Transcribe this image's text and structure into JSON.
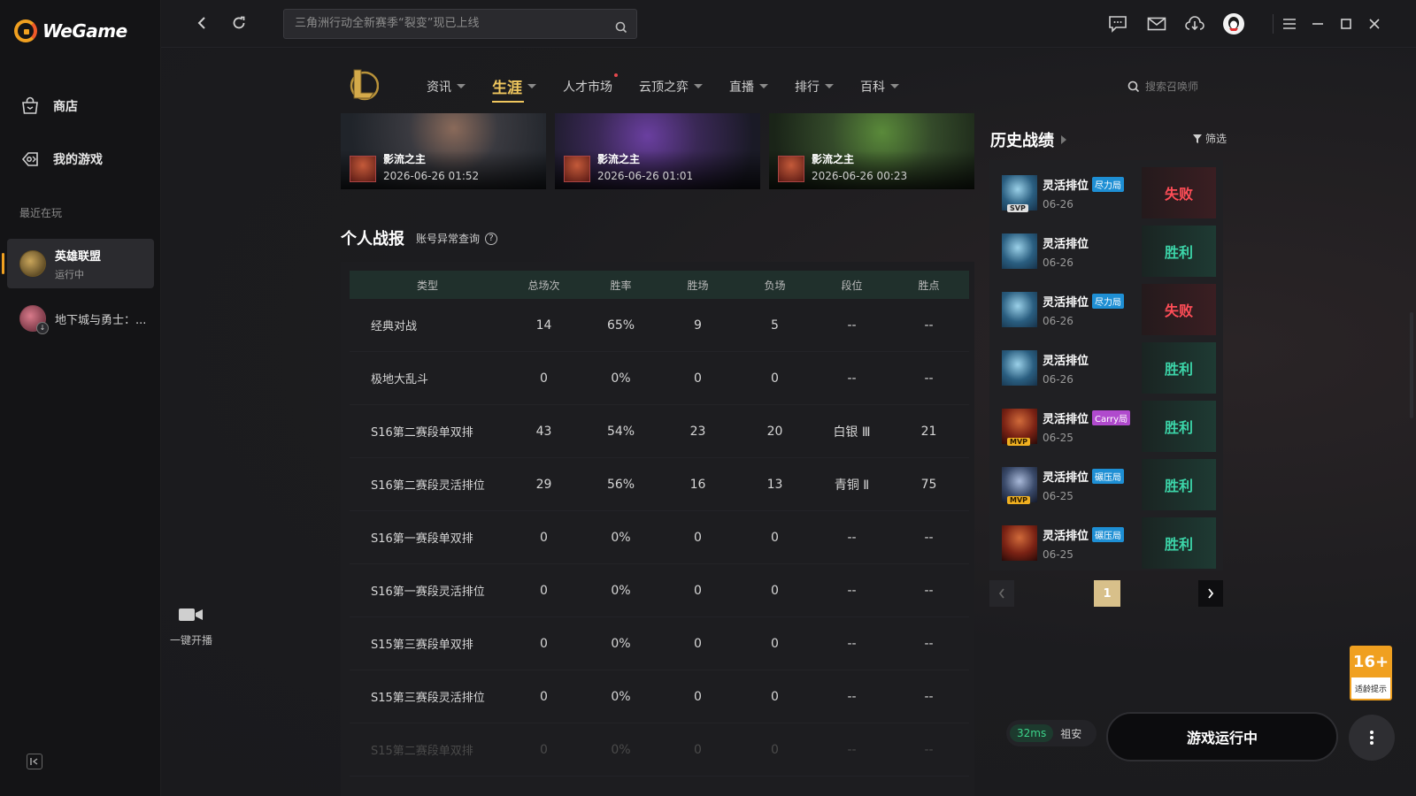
{
  "app": {
    "name": "WeGame"
  },
  "sidebar": {
    "nav": [
      {
        "label": "商店",
        "icon": "store-icon"
      },
      {
        "label": "我的游戏",
        "icon": "my-games-icon"
      }
    ],
    "recent_label": "最近在玩",
    "games": [
      {
        "name": "英雄联盟",
        "status": "运行中"
      },
      {
        "name": "地下城与勇士：..."
      }
    ]
  },
  "topbar": {
    "search_placeholder": "三角洲行动全新赛季“裂变”现已上线"
  },
  "subnav": {
    "tabs": [
      {
        "label": "资讯",
        "dropdown": true
      },
      {
        "label": "生涯",
        "dropdown": true,
        "active": true
      },
      {
        "label": "人才市场",
        "dropdown": false,
        "dot": true
      },
      {
        "label": "云顶之弈",
        "dropdown": true
      },
      {
        "label": "直播",
        "dropdown": true
      },
      {
        "label": "排行",
        "dropdown": true
      },
      {
        "label": "百科",
        "dropdown": true
      }
    ],
    "summoner_search_placeholder": "搜索召唤师"
  },
  "highlights": [
    {
      "title": "影流之主",
      "time": "2026-06-26 01:52"
    },
    {
      "title": "影流之主",
      "time": "2026-06-26 01:01"
    },
    {
      "title": "影流之主",
      "time": "2026-06-26 00:23"
    }
  ],
  "personal_stats": {
    "title": "个人战报",
    "anomaly_link": "账号异常查询",
    "headers": [
      "类型",
      "总场次",
      "胜率",
      "胜场",
      "负场",
      "段位",
      "胜点"
    ],
    "rows": [
      [
        "经典对战",
        "14",
        "65%",
        "9",
        "5",
        "--",
        "--"
      ],
      [
        "极地大乱斗",
        "0",
        "0%",
        "0",
        "0",
        "--",
        "--"
      ],
      [
        "S16第二赛段单双排",
        "43",
        "54%",
        "23",
        "20",
        "白银 Ⅲ",
        "21"
      ],
      [
        "S16第二赛段灵活排位",
        "29",
        "56%",
        "16",
        "13",
        "青铜 Ⅱ",
        "75"
      ],
      [
        "S16第一赛段单双排",
        "0",
        "0%",
        "0",
        "0",
        "--",
        "--"
      ],
      [
        "S16第一赛段灵活排位",
        "0",
        "0%",
        "0",
        "0",
        "--",
        "--"
      ],
      [
        "S15第三赛段单双排",
        "0",
        "0%",
        "0",
        "0",
        "--",
        "--"
      ],
      [
        "S15第三赛段灵活排位",
        "0",
        "0%",
        "0",
        "0",
        "--",
        "--"
      ],
      [
        "S15第二赛段单双排",
        "0",
        "0%",
        "0",
        "0",
        "--",
        "--"
      ]
    ]
  },
  "history": {
    "title": "历史战绩",
    "filter_label": "筛选",
    "matches": [
      {
        "mode": "灵活排位",
        "tag": "尽力局",
        "tag_color": "blue",
        "badge": "SVP",
        "date": "06-26",
        "result": "失败",
        "win": false,
        "champ": "blue"
      },
      {
        "mode": "灵活排位",
        "tag": "",
        "badge": "",
        "date": "06-26",
        "result": "胜利",
        "win": true,
        "champ": "blue"
      },
      {
        "mode": "灵活排位",
        "tag": "尽力局",
        "tag_color": "blue",
        "badge": "",
        "date": "06-26",
        "result": "失败",
        "win": false,
        "champ": "blue"
      },
      {
        "mode": "灵活排位",
        "tag": "",
        "badge": "",
        "date": "06-26",
        "result": "胜利",
        "win": true,
        "champ": "blue"
      },
      {
        "mode": "灵活排位",
        "tag": "Carry局",
        "tag_color": "purple",
        "badge": "MVP",
        "date": "06-25",
        "result": "胜利",
        "win": true,
        "champ": "red"
      },
      {
        "mode": "灵活排位",
        "tag": "碾压局",
        "tag_color": "blue",
        "badge": "MVP",
        "date": "06-25",
        "result": "胜利",
        "win": true,
        "champ": "steel"
      },
      {
        "mode": "灵活排位",
        "tag": "碾压局",
        "tag_color": "blue",
        "badge": "",
        "date": "06-25",
        "result": "胜利",
        "win": true,
        "champ": "red"
      }
    ],
    "current_page": "1"
  },
  "stream": {
    "label": "一键开播"
  },
  "status": {
    "ping": "32ms",
    "location": "祖安",
    "run_button": "游戏运行中",
    "age_rating": "16+",
    "age_sub": "适龄提示"
  },
  "colors": {
    "accent": "#f0c75e",
    "win": "#3cd4a8",
    "lose": "#ff4d57"
  }
}
